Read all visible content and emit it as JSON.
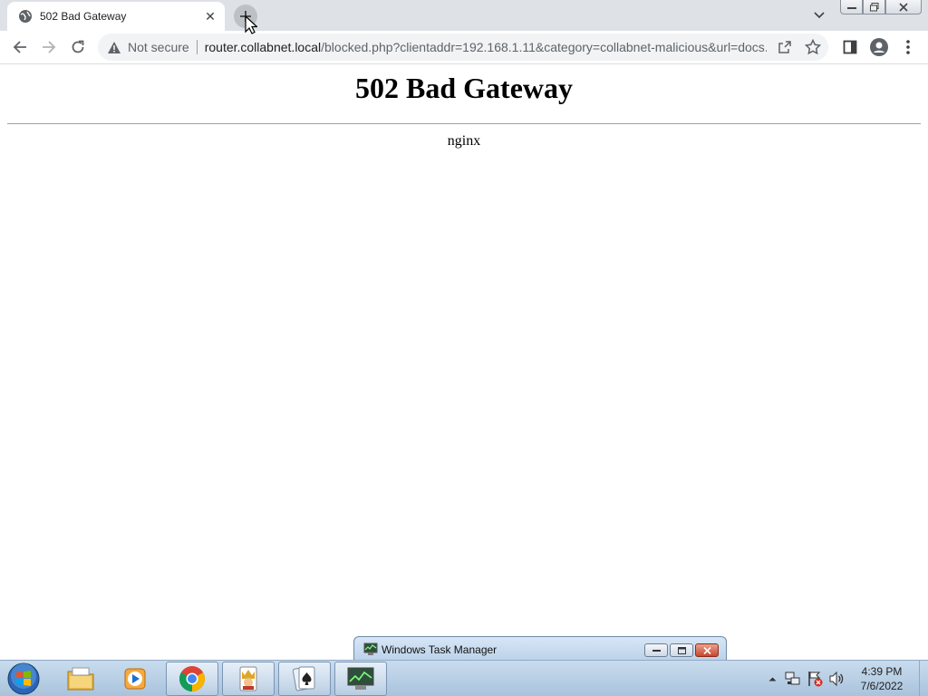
{
  "browser": {
    "tab": {
      "title": "502 Bad Gateway",
      "favicon": "globe-icon",
      "close_glyph": "✕"
    },
    "omnibox": {
      "security_label": "Not secure",
      "url_host": "router.collabnet.local",
      "url_rest": "/blocked.php?clientaddr=192.168.1.11&category=collabnet-malicious&url=docs.mi..."
    }
  },
  "page": {
    "heading": "502 Bad Gateway",
    "server": "nginx"
  },
  "taskbar": {
    "apps": [
      "file-explorer-icon",
      "media-player-icon",
      "chrome-icon",
      "game-hearts-icon",
      "solitaire-icon",
      "task-manager-icon"
    ],
    "preview_window": {
      "title": "Windows Task Manager"
    },
    "clock": {
      "time": "4:39 PM",
      "date": "7/6/2022"
    }
  },
  "colors": {
    "tabstrip": "#dee1e6",
    "omnibox": "#f1f3f4",
    "taskbar": "#b7cfe6"
  }
}
